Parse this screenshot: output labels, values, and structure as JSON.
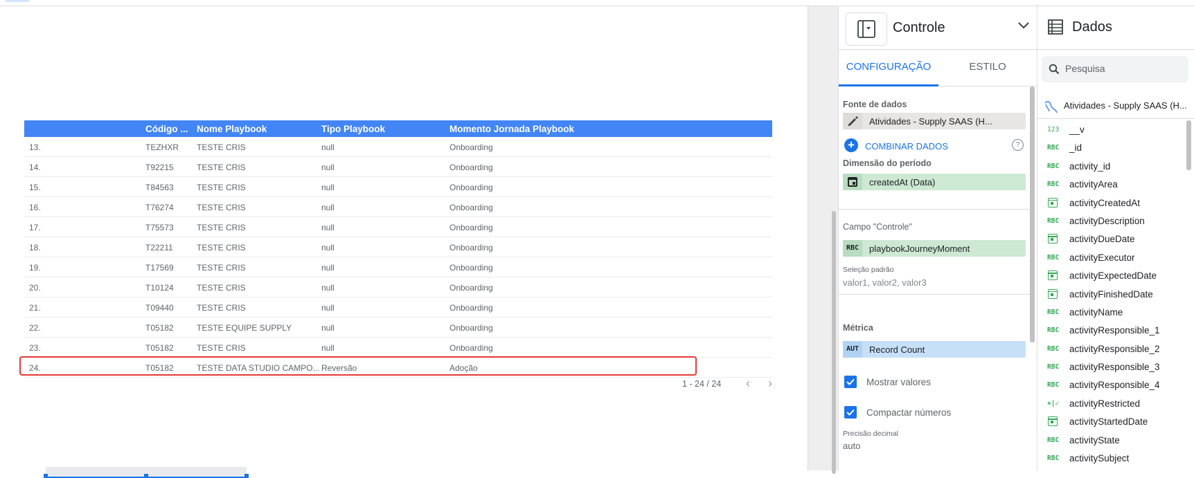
{
  "table": {
    "headers": [
      "",
      "Código ...",
      "Nome Playbook",
      "Tipo Playbook",
      "Momento Jornada Playbook"
    ],
    "rows": [
      [
        "13.",
        "TEZHXR",
        "TESTE CRIS",
        "null",
        "Onboarding"
      ],
      [
        "14.",
        "T92215",
        "TESTE CRIS",
        "null",
        "Onboarding"
      ],
      [
        "15.",
        "T84563",
        "TESTE CRIS",
        "null",
        "Onboarding"
      ],
      [
        "16.",
        "T76274",
        "TESTE CRIS",
        "null",
        "Onboarding"
      ],
      [
        "17.",
        "T75573",
        "TESTE CRIS",
        "null",
        "Onboarding"
      ],
      [
        "18.",
        "T22211",
        "TESTE CRIS",
        "null",
        "Onboarding"
      ],
      [
        "19.",
        "T17569",
        "TESTE CRIS",
        "null",
        "Onboarding"
      ],
      [
        "20.",
        "T10124",
        "TESTE CRIS",
        "null",
        "Onboarding"
      ],
      [
        "21.",
        "T09440",
        "TESTE CRIS",
        "null",
        "Onboarding"
      ],
      [
        "22.",
        "T05182",
        "TESTE EQUIPE SUPPLY",
        "null",
        "Onboarding"
      ],
      [
        "23.",
        "T05182",
        "TESTE CRIS",
        "null",
        "Onboarding"
      ],
      [
        "24.",
        "T05182",
        "TESTE DATA STUDIO CAMPO...",
        "Reversão",
        "Adoção"
      ]
    ],
    "pagination": "1 - 24 / 24"
  },
  "props": {
    "title": "Controle",
    "tabs": [
      "CONFIGURAÇÃO",
      "ESTILO"
    ],
    "data_source_label": "Fonte de dados",
    "data_source_value": "Atividades - Supply SAAS (H...",
    "combine_label": "COMBINAR DADOS",
    "help_glyph": "?",
    "period_label": "Dimensão do período",
    "period_value": "createdAt (Data)",
    "control_field_label": "Campo \"Controle\"",
    "control_field_badge": "RBC",
    "control_field_value": "playbookJourneyMoment",
    "default_sel_label": "Seleção padrão",
    "default_sel_placeholder": "valor1, valor2, valor3",
    "metric_label": "Métrica",
    "metric_badge": "AUT",
    "metric_value": "Record Count",
    "show_values_label": "Mostrar valores",
    "compact_label": "Compactar números",
    "decimal_label": "Precisão decimal",
    "decimal_value": "auto"
  },
  "data_panel": {
    "title": "Dados",
    "search_placeholder": "Pesquisa",
    "source": "Atividades - Supply SAAS (H...",
    "fields": [
      {
        "type": "123",
        "name": "__v"
      },
      {
        "type": "RBC",
        "name": "_id"
      },
      {
        "type": "RBC",
        "name": "activity_id"
      },
      {
        "type": "RBC",
        "name": "activityArea"
      },
      {
        "type": "date",
        "name": "activityCreatedAt"
      },
      {
        "type": "RBC",
        "name": "activityDescription"
      },
      {
        "type": "date",
        "name": "activityDueDate"
      },
      {
        "type": "RBC",
        "name": "activityExecutor"
      },
      {
        "type": "date",
        "name": "activityExpectedDate"
      },
      {
        "type": "date",
        "name": "activityFinishedDate"
      },
      {
        "type": "RBC",
        "name": "activityName"
      },
      {
        "type": "RBC",
        "name": "activityResponsible_1"
      },
      {
        "type": "RBC",
        "name": "activityResponsible_2"
      },
      {
        "type": "RBC",
        "name": "activityResponsible_3"
      },
      {
        "type": "RBC",
        "name": "activityResponsible_4"
      },
      {
        "type": "×|✓",
        "name": "activityRestricted"
      },
      {
        "type": "date",
        "name": "activityStartedDate"
      },
      {
        "type": "RBC",
        "name": "activityState"
      },
      {
        "type": "RBC",
        "name": "activitySubject"
      }
    ]
  },
  "colors": {
    "header_blue": "#4285f4",
    "accent": "#1a73e8",
    "highlight_red": "#e53935",
    "dimension_green": "#cde8d3",
    "metric_blue": "#c6e0f8"
  }
}
